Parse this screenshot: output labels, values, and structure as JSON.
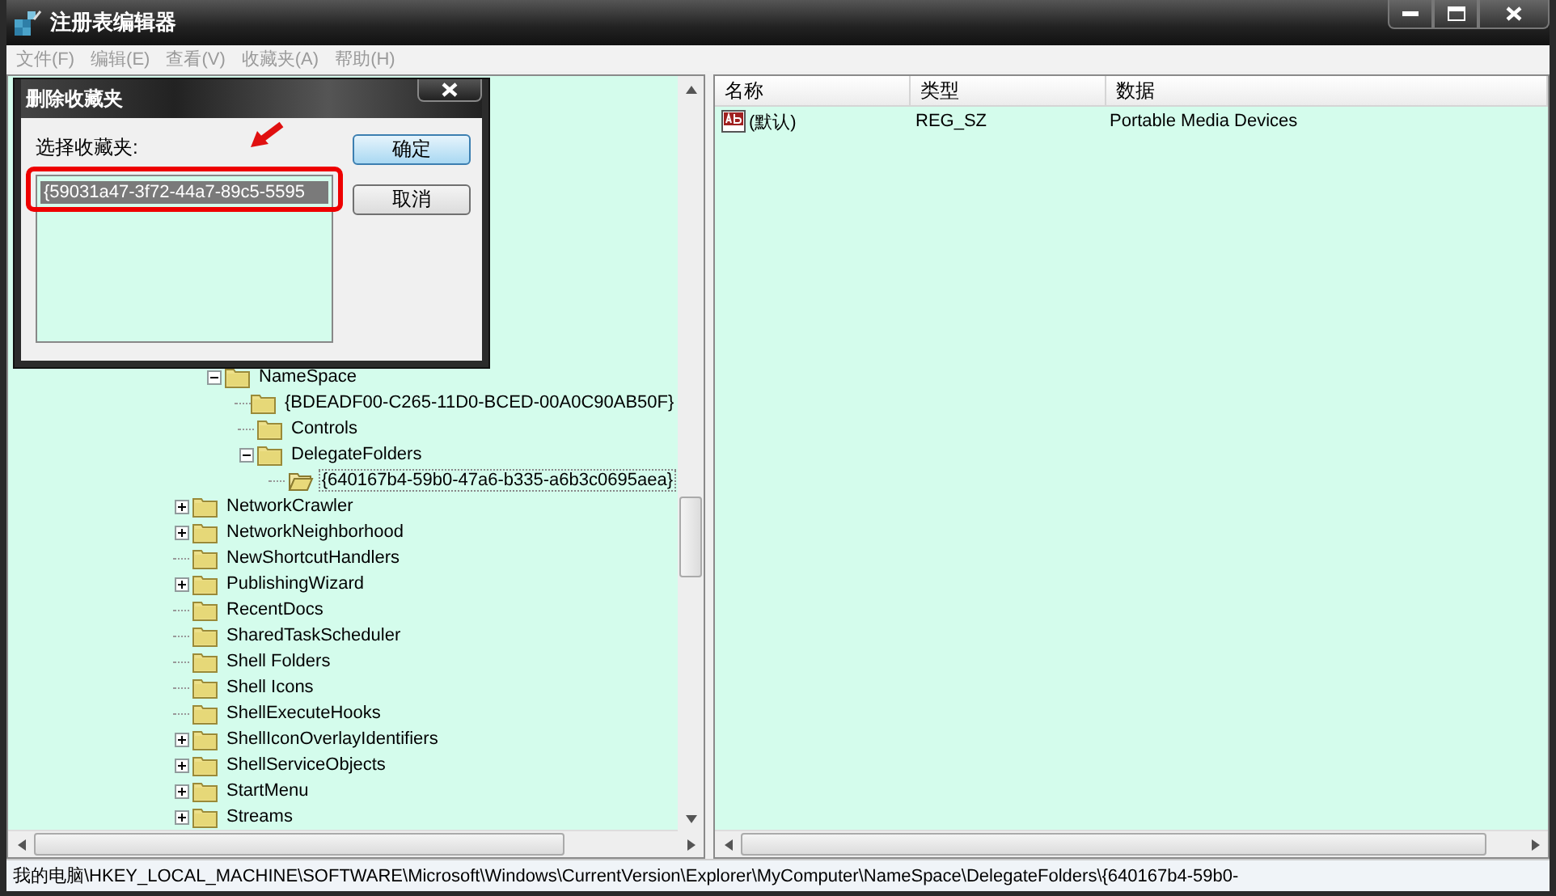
{
  "window": {
    "title": "注册表编辑器"
  },
  "menu": [
    {
      "label": "文件(F)",
      "disabled": true
    },
    {
      "label": "编辑(E)",
      "disabled": true
    },
    {
      "label": "查看(V)",
      "disabled": true
    },
    {
      "label": "收藏夹(A)",
      "disabled": true
    },
    {
      "label": "帮助(H)",
      "disabled": true
    }
  ],
  "tree": {
    "covered_branch": {
      "label": "NameSpace",
      "kind": "branch",
      "expanded": true,
      "selected": false,
      "children": [
        {
          "label": "{BDEADF00-C265-11D0-BCED-00A0C90AB50F}",
          "kind": "leaf",
          "selected": false
        },
        {
          "label": "Controls",
          "kind": "leaf",
          "selected": false
        },
        {
          "label": "DelegateFolders",
          "kind": "branch",
          "expanded": true,
          "selected": false,
          "children": [
            {
              "label": "{640167b4-59b0-47a6-b335-a6b3c0695aea}",
              "kind": "leaf",
              "selected": true
            }
          ]
        }
      ]
    },
    "items": [
      {
        "label": "NetworkCrawler",
        "kind": "branch",
        "expanded": false,
        "selected": false
      },
      {
        "label": "NetworkNeighborhood",
        "kind": "branch",
        "expanded": false,
        "selected": false
      },
      {
        "label": "NewShortcutHandlers",
        "kind": "leaf",
        "selected": false
      },
      {
        "label": "PublishingWizard",
        "kind": "branch",
        "expanded": false,
        "selected": false
      },
      {
        "label": "RecentDocs",
        "kind": "leaf",
        "selected": false
      },
      {
        "label": "SharedTaskScheduler",
        "kind": "leaf",
        "selected": false
      },
      {
        "label": "Shell Folders",
        "kind": "leaf",
        "selected": false
      },
      {
        "label": "Shell Icons",
        "kind": "leaf",
        "selected": false
      },
      {
        "label": "ShellExecuteHooks",
        "kind": "leaf",
        "selected": false
      },
      {
        "label": "ShellIconOverlayIdentifiers",
        "kind": "branch",
        "expanded": false,
        "selected": false
      },
      {
        "label": "ShellServiceObjects",
        "kind": "branch",
        "expanded": false,
        "selected": false
      },
      {
        "label": "StartMenu",
        "kind": "branch",
        "expanded": false,
        "selected": false
      },
      {
        "label": "Streams",
        "kind": "branch",
        "expanded": false,
        "selected": false
      }
    ]
  },
  "values": {
    "columns": [
      "名称",
      "类型",
      "数据"
    ],
    "rows": [
      {
        "name": "(默认)",
        "type": "REG_SZ",
        "data": "Portable Media Devices"
      }
    ]
  },
  "dialog": {
    "title": "删除收藏夹",
    "label": "选择收藏夹:",
    "list": [
      {
        "label": "{59031a47-3f72-44a7-89c5-5595",
        "selected": true
      }
    ],
    "buttons": [
      {
        "label": "确定",
        "default": true
      },
      {
        "label": "取消",
        "default": false
      }
    ]
  },
  "status_bar": "我的电脑\\HKEY_LOCAL_MACHINE\\SOFTWARE\\Microsoft\\Windows\\CurrentVersion\\Explorer\\MyComputer\\NameSpace\\DelegateFolders\\{640167b4-59b0-"
}
